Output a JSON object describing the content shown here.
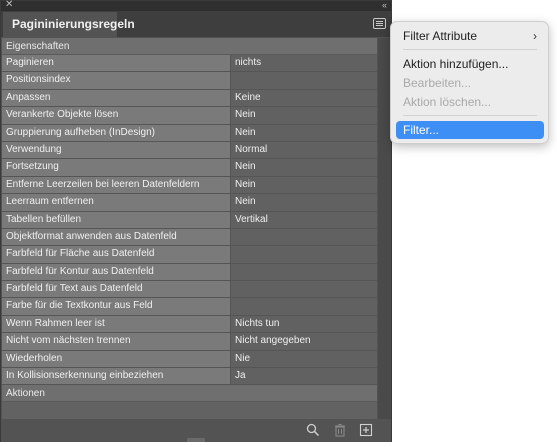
{
  "panel": {
    "close_glyph": "✕",
    "collapse_glyph": "‹‹",
    "tab_title": "Pagininierungsregeln"
  },
  "sections": {
    "properties": "Eigenschaften",
    "actions": "Aktionen"
  },
  "rows": [
    {
      "label": "Paginieren",
      "value": "nichts"
    },
    {
      "label": "Positionsindex",
      "value": ""
    },
    {
      "label": "Anpassen",
      "value": "Keine"
    },
    {
      "label": "Verankerte Objekte lösen",
      "value": "Nein"
    },
    {
      "label": "Gruppierung aufheben (InDesign)",
      "value": "Nein"
    },
    {
      "label": "Verwendung",
      "value": "Normal"
    },
    {
      "label": "Fortsetzung",
      "value": "Nein"
    },
    {
      "label": "Entferne Leerzeilen bei leeren Datenfeldern",
      "value": "Nein"
    },
    {
      "label": "Leerraum entfernen",
      "value": "Nein"
    },
    {
      "label": "Tabellen befüllen",
      "value": "Vertikal"
    },
    {
      "label": "Objektformat anwenden aus Datenfeld",
      "value": ""
    },
    {
      "label": "Farbfeld für Fläche aus Datenfeld",
      "value": ""
    },
    {
      "label": "Farbfeld für Kontur aus Datenfeld",
      "value": ""
    },
    {
      "label": "Farbfeld für Text aus Datenfeld",
      "value": ""
    },
    {
      "label": "Farbe für die Textkontur aus Feld",
      "value": ""
    },
    {
      "label": "Wenn Rahmen leer ist",
      "value": "Nichts tun"
    },
    {
      "label": "Nicht vom nächsten trennen",
      "value": "Nicht angegeben"
    },
    {
      "label": "Wiederholen",
      "value": "Nie"
    },
    {
      "label": "In Kollisionserkennung einbeziehen",
      "value": "Ja"
    }
  ],
  "menu": {
    "filter_attribute": "Filter Attribute",
    "filter_attribute_chevron": "›",
    "add_action": "Aktion hinzufügen...",
    "edit": "Bearbeiten...",
    "delete_action": "Aktion löschen...",
    "filter": "Filter..."
  },
  "colors": {
    "panel_bg": "#535353",
    "highlight": "#3d8ff5"
  }
}
